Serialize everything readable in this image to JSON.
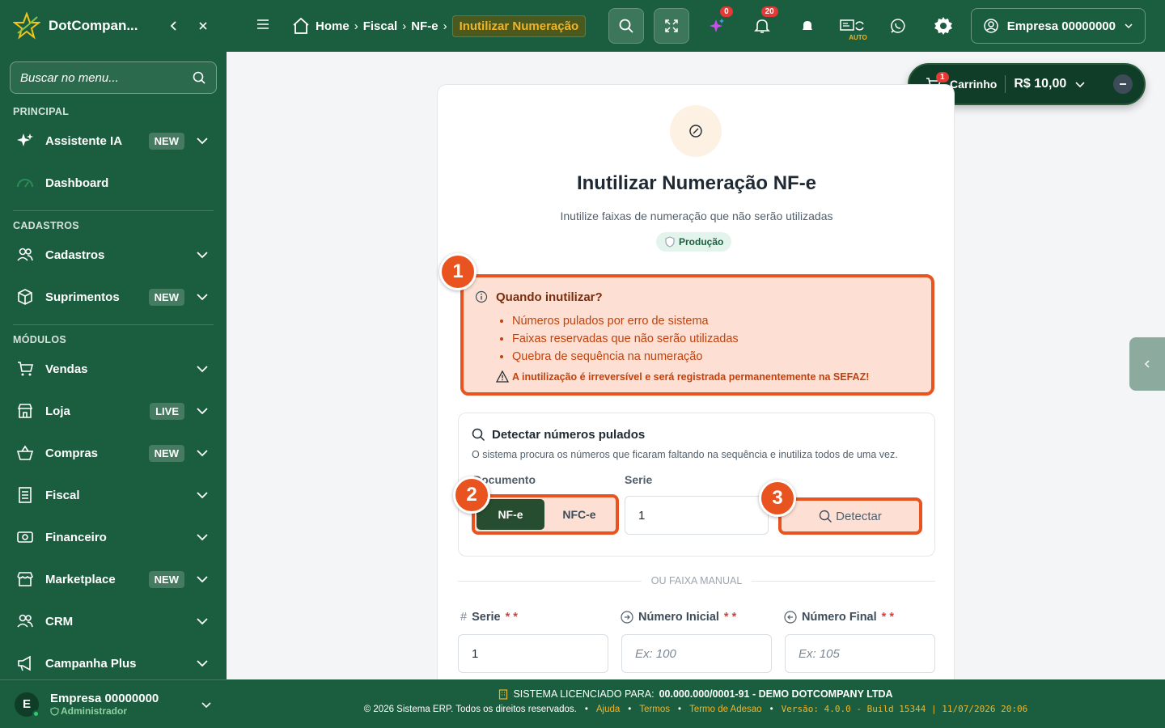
{
  "sidebar": {
    "brand": "DotCompan...",
    "collapse_icon": "chevron-left-icon",
    "close_icon": "close-icon",
    "search_placeholder": "Buscar no menu...",
    "sections": {
      "principal": "PRINCIPAL",
      "cadastros": "CADASTROS",
      "modulos": "MÓDULOS"
    },
    "items": [
      {
        "label": "Assistente IA",
        "badge": "NEW",
        "icon": "sparkles-icon"
      },
      {
        "label": "Dashboard",
        "badge": "",
        "icon": "gauge-icon"
      },
      {
        "label": "Cadastros",
        "badge": "",
        "icon": "users-icon"
      },
      {
        "label": "Suprimentos",
        "badge": "NEW",
        "icon": "box-icon"
      },
      {
        "label": "Vendas",
        "badge": "",
        "icon": "cart-icon"
      },
      {
        "label": "Loja",
        "badge": "LIVE",
        "icon": "store-icon"
      },
      {
        "label": "Compras",
        "badge": "NEW",
        "icon": "basket-icon"
      },
      {
        "label": "Fiscal",
        "badge": "",
        "icon": "receipt-icon"
      },
      {
        "label": "Financeiro",
        "badge": "",
        "icon": "banknote-icon"
      },
      {
        "label": "Marketplace",
        "badge": "NEW",
        "icon": "marketplace-icon"
      },
      {
        "label": "CRM",
        "badge": "",
        "icon": "users-icon"
      },
      {
        "label": "Campanha Plus",
        "badge": "",
        "icon": "megaphone-icon"
      }
    ],
    "footer": {
      "avatar_letter": "E",
      "company": "Empresa 00000000",
      "role": "Administrador"
    }
  },
  "topbar": {
    "breadcrumb": [
      "Home",
      "Fiscal",
      "NF-e"
    ],
    "breadcrumb_current": "Inutilizar Numeração",
    "notif_ia_count": "0",
    "notif_count": "20",
    "auto_label": "AUTO",
    "company": "Empresa 00000000"
  },
  "cart": {
    "count": "1",
    "label": "Carrinho",
    "total": "R$ 10,00"
  },
  "main": {
    "title": "Inutilizar Numeração NF-e",
    "subtitle": "Inutilize faixas de numeração que não serão utilizadas",
    "env_badge": "Produção",
    "alert": {
      "title": "Quando inutilizar?",
      "bullets": [
        "Números pulados por erro de sistema",
        "Faixas reservadas que não serão utilizadas",
        "Quebra de sequência na numeração"
      ],
      "warning": "A inutilização é irreversível e será registrada permanentemente na SEFAZ!"
    },
    "detect": {
      "title": "Detectar números pulados",
      "description": "O sistema procura os números que ficaram faltando na sequência e inutiliza todos de uma vez.",
      "doc_label": "Documento",
      "doc_options": [
        "NF-e",
        "NFC-e"
      ],
      "doc_selected": "NF-e",
      "serie_label": "Serie",
      "serie_value": "1",
      "button": "Detectar"
    },
    "divider": "OU FAIXA MANUAL",
    "manual": {
      "serie_label": "Serie",
      "serie_value": "1",
      "inicial_label": "Número Inicial",
      "inicial_placeholder": "Ex: 100",
      "final_label": "Número Final",
      "final_placeholder": "Ex: 105",
      "required_mark": "* *"
    },
    "markers": [
      "1",
      "2",
      "3"
    ]
  },
  "footer": {
    "license_prefix": "SISTEMA LICENCIADO PARA:",
    "license_value": "00.000.000/0001-91 - DEMO DOTCOMPANY LTDA",
    "copyright": "© 2026 Sistema ERP. Todos os direitos reservados.",
    "links": [
      "Ajuda",
      "Termos",
      "Termo de Adesao"
    ],
    "version": "Versão: 4.0.0 - Build 15344 | 11/07/2026 20:06"
  },
  "colors": {
    "brand_green": "#1b5e3f",
    "accent_orange": "#e8531f",
    "alert_bg": "#fde0d3",
    "gold": "#f0b429"
  }
}
